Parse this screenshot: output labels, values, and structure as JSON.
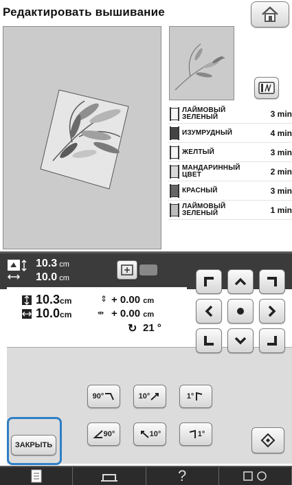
{
  "title": "Редактировать вышивание",
  "colors": [
    {
      "name": "ЛАЙМОВЫЙ ЗЕЛЕНЫЙ",
      "time": "3 min",
      "swatch": "#f4f4f4"
    },
    {
      "name": "ИЗУМРУДНЫЙ",
      "time": "4 min",
      "swatch": "#444444"
    },
    {
      "name": "ЖЕЛТЫЙ",
      "time": "3 min",
      "swatch": "#f4f4f4"
    },
    {
      "name": "МАНДАРИННЫЙ ЦВЕТ",
      "time": "2 min",
      "swatch": "#d8d8d8"
    },
    {
      "name": "КРАСНЫЙ",
      "time": "3 min",
      "swatch": "#666666"
    },
    {
      "name": "ЛАЙМОВЫЙ ЗЕЛЕНЫЙ",
      "time": "1 min",
      "swatch": "#bdbdbd"
    }
  ],
  "size_bar": {
    "height": "10.3",
    "width": "10.0",
    "unit": "cm"
  },
  "info": {
    "height": "10.3",
    "width": "10.0",
    "unit": "cm",
    "vshift": "+ 0.00",
    "hshift": "+ 0.00",
    "angle": "21 °"
  },
  "rotate": {
    "r90": "90°",
    "r10": "10°",
    "r1": "1°",
    "l90": "90°",
    "l10": "10°",
    "l1": "1°"
  },
  "close_label": "ЗАКРЫТЬ",
  "icons": {
    "home": "home-icon",
    "memory": "memory-icon",
    "frame": "frame-icon",
    "reset": "reset-icon"
  }
}
